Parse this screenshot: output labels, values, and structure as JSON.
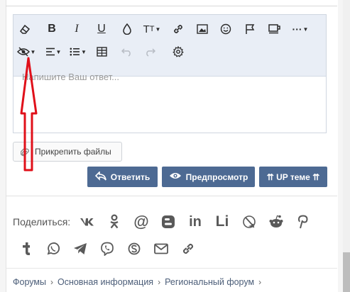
{
  "editor": {
    "placeholder": "Напишите Ваш ответ...",
    "toolbar_icons": [
      "eraser-icon",
      "bold-icon",
      "italic-icon",
      "underline-icon",
      "color-icon",
      "text-size-icon",
      "link-icon",
      "image-icon",
      "smilie-icon",
      "flag-icon",
      "insert-icon",
      "more-icon",
      "spoiler-icon",
      "align-icon",
      "list-icon",
      "table-icon",
      "undo-icon",
      "redo-icon",
      "settings-icon"
    ]
  },
  "actions": {
    "attach_label": "Прикрепить файлы",
    "reply_label": "Ответить",
    "preview_label": "Предпросмотр",
    "up_label": "⇈ UP теме ⇈"
  },
  "share": {
    "label": "Поделиться:",
    "li_text": "Li",
    "networks": [
      "vk",
      "odnoklassniki",
      "mail-ru",
      "blogger",
      "linkedin",
      "liveinternet",
      "livejournal",
      "reddit",
      "pinterest",
      "tumblr",
      "whatsapp",
      "telegram",
      "viber",
      "skype",
      "email",
      "link"
    ]
  },
  "breadcrumbs": [
    "Форумы",
    "Основная информация",
    "Региональный форум"
  ],
  "colors": {
    "toolbar_bg": "#e9eef6",
    "button_bg": "#4d6a93",
    "annotation_red": "#e0101a"
  }
}
